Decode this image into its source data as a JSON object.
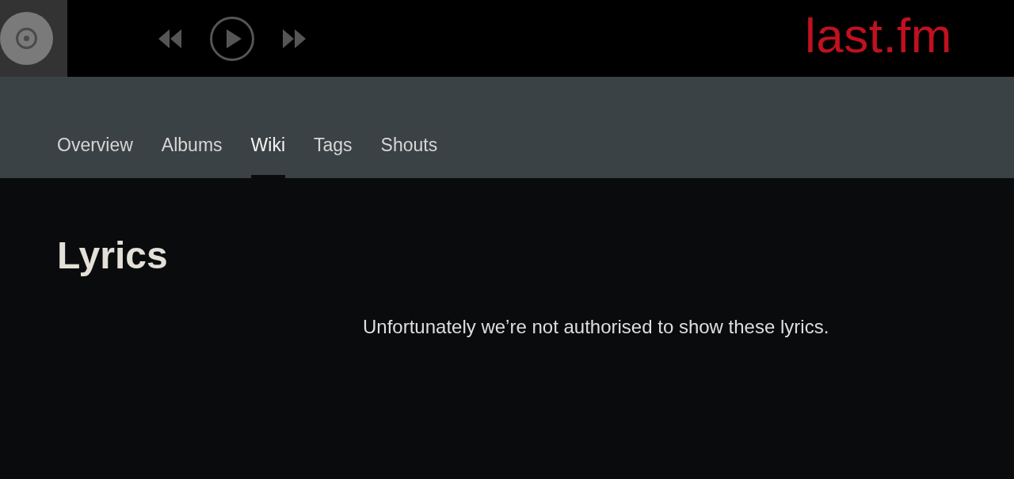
{
  "player": {
    "logo": "last.fm"
  },
  "tabs": [
    {
      "label": "Overview",
      "selected": false
    },
    {
      "label": "Albums",
      "selected": false
    },
    {
      "label": "Wiki",
      "selected": true
    },
    {
      "label": "Tags",
      "selected": false
    },
    {
      "label": "Shouts",
      "selected": false
    }
  ],
  "section": {
    "heading": "Lyrics",
    "message": "Unfortunately we’re not authorised to show these lyrics."
  }
}
